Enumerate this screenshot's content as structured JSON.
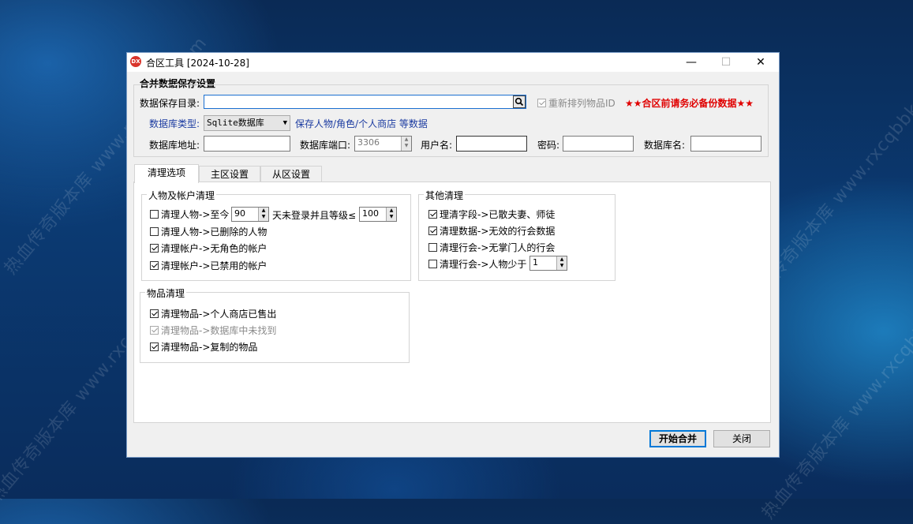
{
  "window": {
    "title": "合区工具 [2024-10-28]",
    "icon_text": "DX",
    "min_glyph": "—",
    "max_glyph": "☐",
    "close_glyph": "✕"
  },
  "save_settings": {
    "group_title": "合并数据保存设置",
    "dir_label": "数据保存目录:",
    "dir_value": "",
    "reorder_label": "重新排列物品ID",
    "reorder_checked": true,
    "warning": "★★合区前请务必备份数据★★",
    "db_type_label": "数据库类型:",
    "db_type_value": "Sqlite数据库",
    "db_type_note": "保存人物/角色/个人商店 等数据",
    "db_addr_label": "数据库地址:",
    "db_addr_value": "",
    "db_port_label": "数据库端口:",
    "db_port_value": "3306",
    "user_label": "用户名:",
    "user_value": "",
    "password_label": "密码:",
    "password_value": "",
    "db_name_label": "数据库名:",
    "db_name_value": ""
  },
  "tabs": [
    {
      "label": "清理选项",
      "active": true
    },
    {
      "label": "主区设置",
      "active": false
    },
    {
      "label": "从区设置",
      "active": false
    }
  ],
  "char_cleanup": {
    "title": "人物及帐户清理",
    "row1_prefix": "清理人物->至今",
    "row1_days": "90",
    "row1_mid": "天未登录并且等级≤",
    "row1_level": "100",
    "row2": "清理人物->已删除的人物",
    "row3": "清理帐户->无角色的帐户",
    "row4": "清理帐户->已禁用的帐户"
  },
  "other_cleanup": {
    "title": "其他清理",
    "row1": "理清字段->已散夫妻、师徒",
    "row2": "清理数据->无效的行会数据",
    "row3": "清理行会->无掌门人的行会",
    "row4_prefix": "清理行会->人物少于",
    "row4_value": "1"
  },
  "item_cleanup": {
    "title": "物品清理",
    "row1": "清理物品->个人商店已售出",
    "row2": "清理物品->数据库中未找到",
    "row3": "清理物品->复制的物品"
  },
  "buttons": {
    "start": "开始合并",
    "close": "关闭"
  },
  "watermark": "热血传奇版本库 www.rxcqbbk.com"
}
